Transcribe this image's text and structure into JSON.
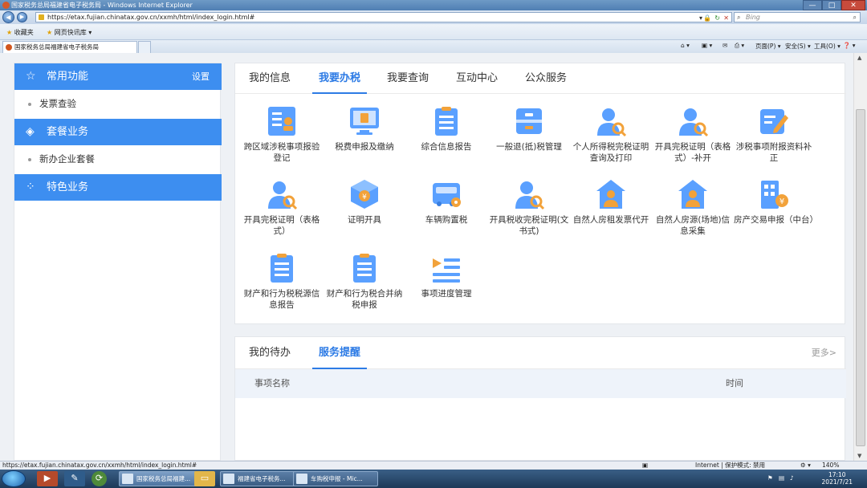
{
  "window": {
    "title": "国家税务总局福建省电子税务局 - Windows Internet Explorer",
    "min": "—",
    "max": "□",
    "close": "✕"
  },
  "address": {
    "url": "https://etax.fujian.chinatax.gov.cn/xxmh/html/index_login.html#",
    "search_placeholder": "Bing"
  },
  "favorites": {
    "favorites_label": "收藏夹",
    "quick_label": "网页快讯库 ▾"
  },
  "tab": {
    "title": "国家税务总局福建省电子税务局"
  },
  "commandbar": {
    "page": "页面(P) ▾",
    "safety": "安全(S) ▾",
    "tools": "工具(O) ▾",
    "help": "❓ ▾"
  },
  "sidebar": {
    "common": {
      "label": "常用功能",
      "setting": "设置"
    },
    "common_items": [
      "发票查验"
    ],
    "package": {
      "label": "套餐业务"
    },
    "package_items": [
      "新办企业套餐"
    ],
    "special": {
      "label": "特色业务"
    }
  },
  "main": {
    "tabs": [
      "我的信息",
      "我要办税",
      "我要查询",
      "互动中心",
      "公众服务"
    ],
    "active_tab": "我要办税",
    "items": [
      {
        "label": "跨区域涉税事项报验登记",
        "icon": "id-card-icon"
      },
      {
        "label": "税费申报及缴纳",
        "icon": "monitor-icon"
      },
      {
        "label": "综合信息报告",
        "icon": "clipboard-icon"
      },
      {
        "label": "一般退(抵)税管理",
        "icon": "drawer-icon"
      },
      {
        "label": "个人所得税完税证明查询及打印",
        "icon": "person-search-icon"
      },
      {
        "label": "开具完税证明（表格式）-补开",
        "icon": "person-search-icon"
      },
      {
        "label": "涉税事项附报资料补正",
        "icon": "edit-icon"
      },
      {
        "label": "开具完税证明（表格式）",
        "icon": "person-search-icon"
      },
      {
        "label": "证明开具",
        "icon": "cube-yuan-icon"
      },
      {
        "label": "车辆购置税",
        "icon": "vehicle-gear-icon"
      },
      {
        "label": "开具税收完税证明(文书式)",
        "icon": "person-search-icon"
      },
      {
        "label": "自然人房租发票代开",
        "icon": "house-person-icon"
      },
      {
        "label": "自然人房源(场地)信息采集",
        "icon": "house-person-icon"
      },
      {
        "label": "房产交易申报（中台）",
        "icon": "building-yuan-icon"
      },
      {
        "label": "财产和行为税税源信息报告",
        "icon": "clipboard-icon"
      },
      {
        "label": "财产和行为税合并纳税申报",
        "icon": "clipboard-icon"
      },
      {
        "label": "事项进度管理",
        "icon": "list-progress-icon"
      }
    ]
  },
  "todo": {
    "tabs": [
      "我的待办",
      "服务提醒"
    ],
    "active_tab": "服务提醒",
    "more": "更多>",
    "columns": [
      "事项名称",
      "时间"
    ]
  },
  "status": {
    "url": "https://etax.fujian.chinatax.gov.cn/xxmh/html/index_login.html#",
    "zone": "Internet | 保护模式: 禁用",
    "zoom": "140%"
  },
  "taskbar": {
    "tasks": [
      "国家税务总局福建...",
      "福建省电子税务...",
      "车购税申报 - Mic..."
    ],
    "time": "17:10",
    "date": "2021/7/21"
  }
}
